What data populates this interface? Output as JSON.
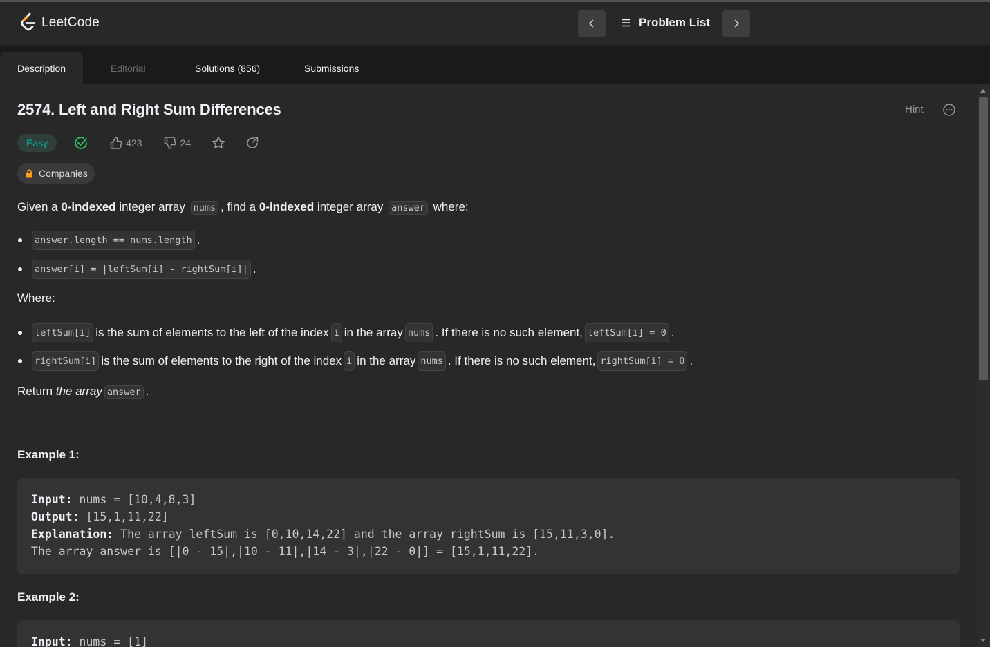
{
  "app": {
    "name": "LeetCode"
  },
  "header": {
    "problem_list_label": "Problem List"
  },
  "tabs": [
    {
      "label": "Description",
      "active": true
    },
    {
      "label": "Editorial",
      "disabled": true
    },
    {
      "label": "Solutions (856)"
    },
    {
      "label": "Submissions"
    }
  ],
  "problem": {
    "title": "2574. Left and Right Sum Differences",
    "difficulty": "Easy",
    "likes": "423",
    "dislikes": "24",
    "hint_label": "Hint",
    "companies_label": "Companies"
  },
  "description": {
    "intro": {
      "t1": "Given a ",
      "b1": "0-indexed",
      "t2": " integer array ",
      "c1": "nums",
      "t3": ", find a ",
      "b2": "0-indexed",
      "t4": " integer array ",
      "c2": "answer",
      "t5": " where:"
    },
    "conditions": [
      {
        "code": "answer.length == nums.length",
        "suffix": "."
      },
      {
        "code": "answer[i] = |leftSum[i] - rightSum[i]|",
        "suffix": "."
      }
    ],
    "where_label": "Where:",
    "definitions": [
      {
        "c1": "leftSum[i]",
        "t1": " is the sum of elements to the left of the index ",
        "c2": "i",
        "t2": " in the array ",
        "c3": "nums",
        "t3": ". If there is no such element, ",
        "c4": "leftSum[i] = 0",
        "t4": "."
      },
      {
        "c1": "rightSum[i]",
        "t1": " is the sum of elements to the right of the index ",
        "c2": "i",
        "t2": " in the array ",
        "c3": "nums",
        "t3": ". If there is no such element, ",
        "c4": "rightSum[i] = 0",
        "t4": "."
      }
    ],
    "return": {
      "t1": "Return ",
      "em": "the array",
      "c1": "answer",
      "t2": "."
    }
  },
  "examples": [
    {
      "title": "Example 1:",
      "input_label": "Input:",
      "input": " nums = [10,4,8,3]",
      "output_label": "Output:",
      "output": " [15,1,11,22]",
      "explanation_label": "Explanation:",
      "explanation": " The array leftSum is [0,10,14,22] and the array rightSum is [15,11,3,0].",
      "explanation_2": "The array answer is [|0 - 15|,|10 - 11|,|14 - 3|,|22 - 0|] = [15,1,11,22]."
    },
    {
      "title": "Example 2:",
      "input_label": "Input:",
      "input": " nums = [1]"
    }
  ],
  "colors": {
    "easy": "#00b8a3",
    "accepted": "#2cbb5d",
    "background": "#282828",
    "tabbar": "#1a1a1a"
  }
}
